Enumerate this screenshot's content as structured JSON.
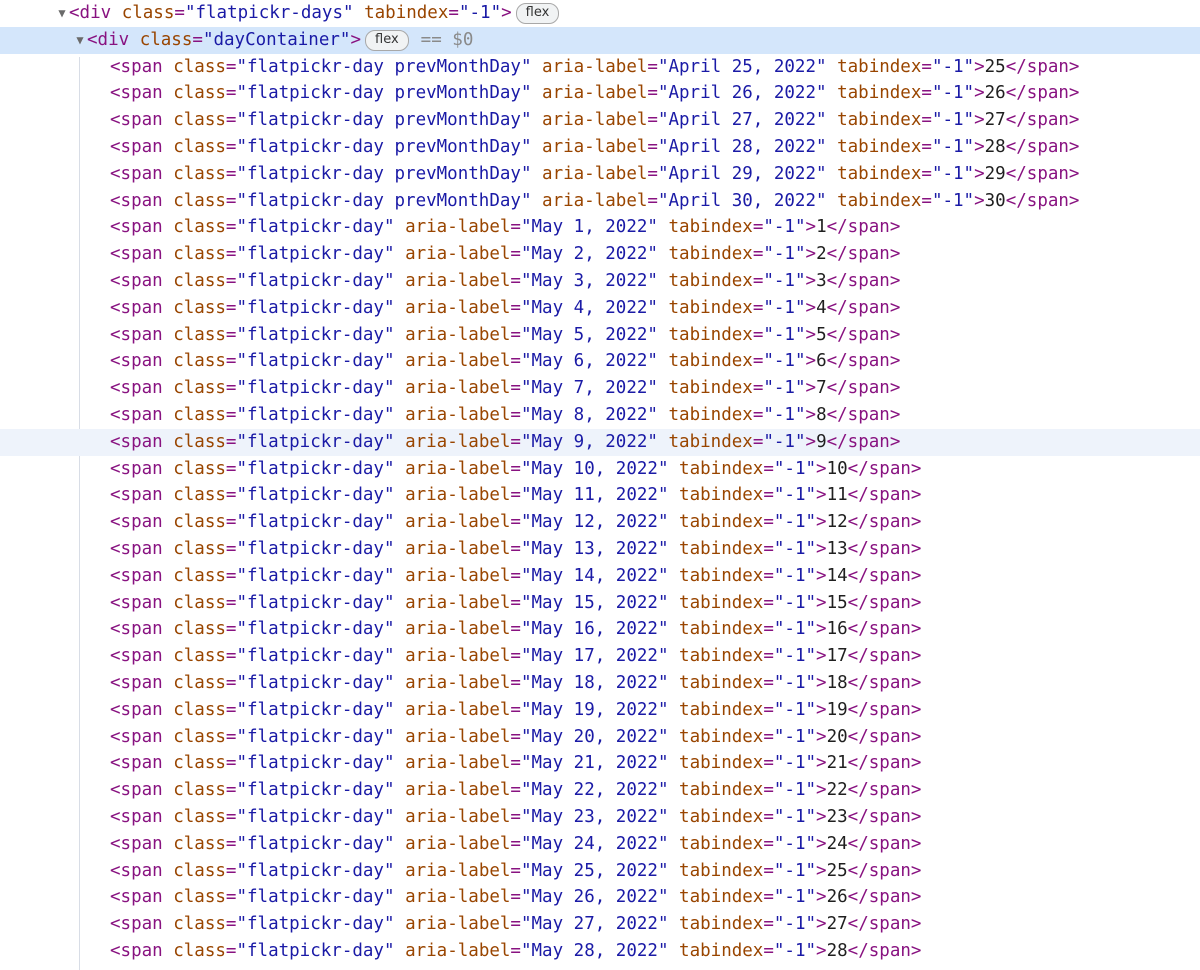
{
  "parent": {
    "tag": "div",
    "class_attr": "class",
    "class_value": "flatpickr-days",
    "tabindex_attr": "tabindex",
    "tabindex_value": "-1",
    "badge": "flex"
  },
  "container": {
    "tag": "div",
    "class_attr": "class",
    "class_value": "dayContainer",
    "badge": "flex",
    "console_ref": "== $0"
  },
  "day_rows": [
    {
      "cls": "flatpickr-day prevMonthDay",
      "label": "April 25, 2022",
      "text": "25"
    },
    {
      "cls": "flatpickr-day prevMonthDay",
      "label": "April 26, 2022",
      "text": "26"
    },
    {
      "cls": "flatpickr-day prevMonthDay",
      "label": "April 27, 2022",
      "text": "27"
    },
    {
      "cls": "flatpickr-day prevMonthDay",
      "label": "April 28, 2022",
      "text": "28"
    },
    {
      "cls": "flatpickr-day prevMonthDay",
      "label": "April 29, 2022",
      "text": "29"
    },
    {
      "cls": "flatpickr-day prevMonthDay",
      "label": "April 30, 2022",
      "text": "30"
    },
    {
      "cls": "flatpickr-day",
      "label": "May 1, 2022",
      "text": "1"
    },
    {
      "cls": "flatpickr-day",
      "label": "May 2, 2022",
      "text": "2"
    },
    {
      "cls": "flatpickr-day",
      "label": "May 3, 2022",
      "text": "3"
    },
    {
      "cls": "flatpickr-day",
      "label": "May 4, 2022",
      "text": "4"
    },
    {
      "cls": "flatpickr-day",
      "label": "May 5, 2022",
      "text": "5"
    },
    {
      "cls": "flatpickr-day",
      "label": "May 6, 2022",
      "text": "6"
    },
    {
      "cls": "flatpickr-day",
      "label": "May 7, 2022",
      "text": "7"
    },
    {
      "cls": "flatpickr-day",
      "label": "May 8, 2022",
      "text": "8"
    },
    {
      "cls": "flatpickr-day",
      "label": "May 9, 2022",
      "text": "9",
      "hovered": true
    },
    {
      "cls": "flatpickr-day",
      "label": "May 10, 2022",
      "text": "10"
    },
    {
      "cls": "flatpickr-day",
      "label": "May 11, 2022",
      "text": "11"
    },
    {
      "cls": "flatpickr-day",
      "label": "May 12, 2022",
      "text": "12"
    },
    {
      "cls": "flatpickr-day",
      "label": "May 13, 2022",
      "text": "13"
    },
    {
      "cls": "flatpickr-day",
      "label": "May 14, 2022",
      "text": "14"
    },
    {
      "cls": "flatpickr-day",
      "label": "May 15, 2022",
      "text": "15"
    },
    {
      "cls": "flatpickr-day",
      "label": "May 16, 2022",
      "text": "16"
    },
    {
      "cls": "flatpickr-day",
      "label": "May 17, 2022",
      "text": "17"
    },
    {
      "cls": "flatpickr-day",
      "label": "May 18, 2022",
      "text": "18"
    },
    {
      "cls": "flatpickr-day",
      "label": "May 19, 2022",
      "text": "19"
    },
    {
      "cls": "flatpickr-day",
      "label": "May 20, 2022",
      "text": "20"
    },
    {
      "cls": "flatpickr-day",
      "label": "May 21, 2022",
      "text": "21"
    },
    {
      "cls": "flatpickr-day",
      "label": "May 22, 2022",
      "text": "22"
    },
    {
      "cls": "flatpickr-day",
      "label": "May 23, 2022",
      "text": "23"
    },
    {
      "cls": "flatpickr-day",
      "label": "May 24, 2022",
      "text": "24"
    },
    {
      "cls": "flatpickr-day",
      "label": "May 25, 2022",
      "text": "25"
    },
    {
      "cls": "flatpickr-day",
      "label": "May 26, 2022",
      "text": "26"
    },
    {
      "cls": "flatpickr-day",
      "label": "May 27, 2022",
      "text": "27"
    },
    {
      "cls": "flatpickr-day",
      "label": "May 28, 2022",
      "text": "28"
    }
  ],
  "colors": {
    "tag": "#881280",
    "attr_name": "#994500",
    "attr_value": "#1a1aa6",
    "selected_row": "#d4e6fb",
    "hovered_row": "#eef3fb"
  }
}
